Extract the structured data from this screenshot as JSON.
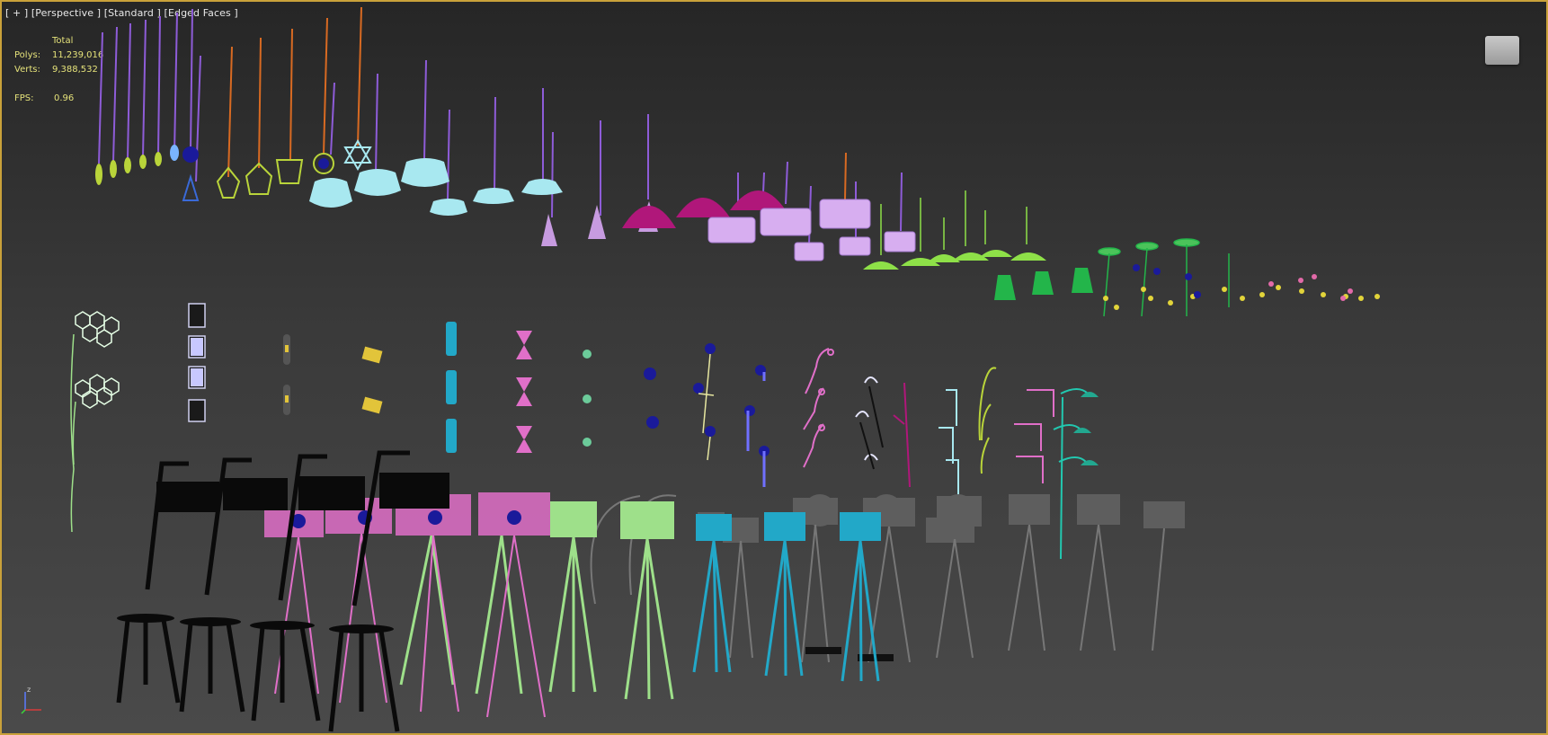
{
  "viewport": {
    "label_plus": "[ + ]",
    "label_view": "[Perspective ]",
    "label_shading": "[Standard ]",
    "label_faces": "[Edged Faces ]"
  },
  "stats": {
    "header": "Total",
    "polys_label": "Polys:",
    "polys_value": "11,239,016",
    "verts_label": "Verts:",
    "verts_value": "9,388,532",
    "fps_label": "FPS:",
    "fps_value": "0.96"
  },
  "viewcube": {
    "label": ""
  },
  "axis": {
    "z_label": "z"
  },
  "colors": {
    "border": "#c9a13a",
    "stats_text": "#e5e27a",
    "violet_wire": "#8e5cd8",
    "orange_wire": "#d86a22",
    "light_cyan": "#a8e8f0",
    "lavender": "#c79be0",
    "magenta": "#b0177a",
    "lime": "#8ee048",
    "green": "#23b54a",
    "black": "#0a0a0a",
    "pink": "#e06fc8",
    "mint": "#9ee08a",
    "teal": "#22a8c8",
    "grey": "#666666"
  }
}
